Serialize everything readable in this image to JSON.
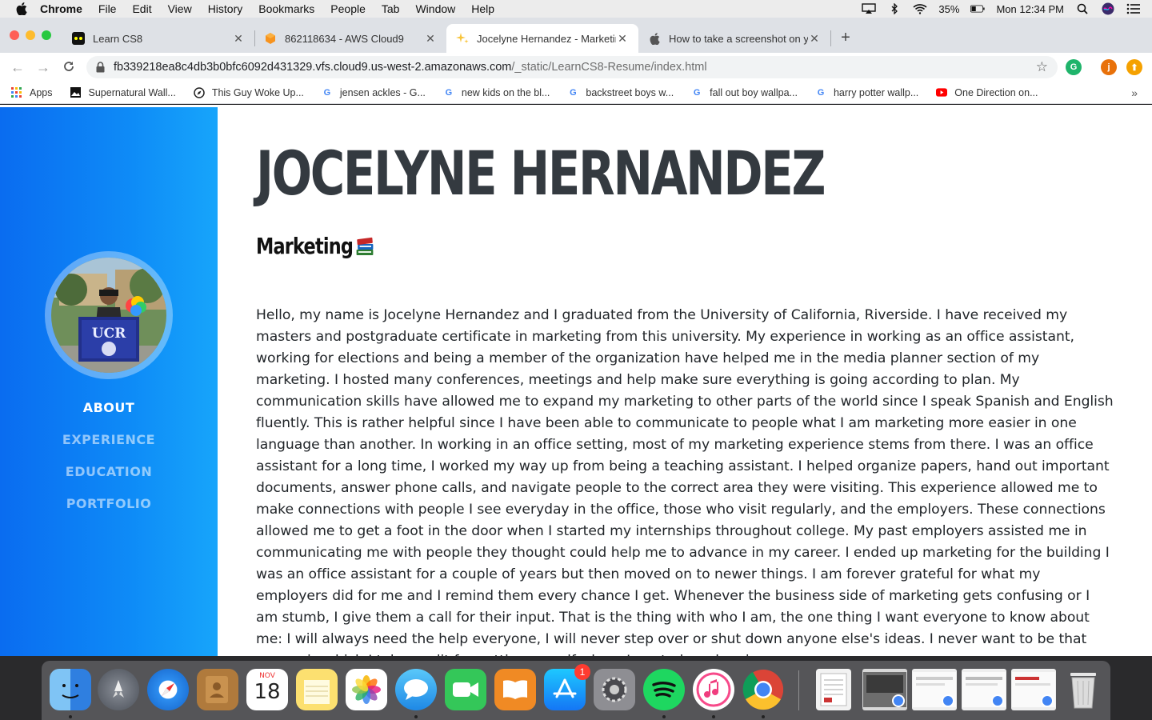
{
  "menubar": {
    "app": "Chrome",
    "items": [
      "File",
      "Edit",
      "View",
      "History",
      "Bookmarks",
      "People",
      "Tab",
      "Window",
      "Help"
    ],
    "battery": "35%",
    "clock": "Mon 12:34 PM"
  },
  "tabs": [
    {
      "title": "Learn CS8"
    },
    {
      "title": "862118634 - AWS Cloud9"
    },
    {
      "title": "Jocelyne Hernandez - Marketin"
    },
    {
      "title": "How to take a screenshot on yo"
    }
  ],
  "address": {
    "url_main": "fb339218ea8c4db3b0bfc6092d431329.vfs.cloud9.us-west-2.amazonaws.com",
    "url_path": "/_static/LearnCS8-Resume/index.html"
  },
  "extensions": {
    "profile_initial": "j"
  },
  "bookmarks": [
    {
      "label": "Apps"
    },
    {
      "label": "Supernatural Wall..."
    },
    {
      "label": "This Guy Woke Up..."
    },
    {
      "label": "jensen ackles - G..."
    },
    {
      "label": "new kids on the bl..."
    },
    {
      "label": "backstreet boys w..."
    },
    {
      "label": "fall out boy wallpa..."
    },
    {
      "label": "harry potter wallp..."
    },
    {
      "label": "One Direction on..."
    }
  ],
  "page": {
    "name": "JOCELYNE HERNANDEZ",
    "role": "Marketing",
    "avatar_sign": "UCR",
    "nav": [
      "ABOUT",
      "EXPERIENCE",
      "EDUCATION",
      "PORTFOLIO"
    ],
    "bio": "Hello, my name is Jocelyne Hernandez and I graduated from the University of California, Riverside. I have received my masters and postgraduate certificate in marketing from this university. My experience in working as an office assistant, working for elections and being a member of the organization have helped me in the media planner section of my marketing. I hosted many conferences, meetings and help make sure everything is going according to plan. My communication skills have allowed me to expand my marketing to other parts of the world since I speak Spanish and English fluently. This is rather helpful since I have been able to communicate to people what I am marketing more easier in one language than another. In working in an office setting, most of my marketing experience stems from there. I was an office assistant for a long time, I worked my way up from being a teaching assistant. I helped organize papers, hand out important documents, answer phone calls, and navigate people to the correct area they were visiting. This experience allowed me to make connections with people I see everyday in the office, those who visit regularly, and the employers. These connections allowed me to get a foot in the door when I started my internships throughout college. My past employers assisted me in communicating me with people they thought could help me to advance in my career. I ended up marketing for the building I was an office assistant for a couple of years but then moved on to newer things. I am forever grateful for what my employers did for me and I remind them every chance I get. Whenever the business side of marketing gets confusing or I am stumb, I give them a call for their input. That is the thing with who I am, the one thing I want everyone to know about me: I will always need the help everyone, I will never step over or shut down anyone else's ideas. I never want to be that person in which I take credit for getting myself where I am today when in"
  },
  "dock": {
    "calendar_month": "NOV",
    "calendar_day": "18",
    "appstore_badge": "1"
  },
  "colors": {
    "sidebar_start": "#0a6cf0",
    "sidebar_end": "#17a5fb",
    "heading": "#343a40"
  }
}
